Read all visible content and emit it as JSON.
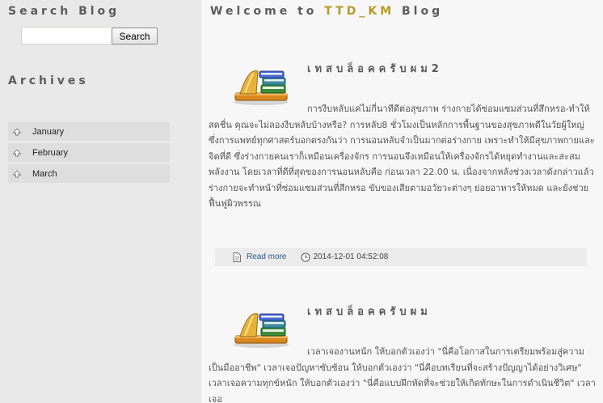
{
  "sidebar": {
    "search_heading": "Search Blog",
    "search_placeholder": "",
    "search_button": "Search",
    "archives_heading": "Archives",
    "archives": [
      {
        "label": "January",
        "icon": "arrow-up-icon"
      },
      {
        "label": "February",
        "icon": "arrow-up-icon"
      },
      {
        "label": "March",
        "icon": "arrow-up-icon"
      }
    ]
  },
  "main": {
    "welcome_prefix": "Welcome to",
    "welcome_brand": "TTD_KM",
    "welcome_suffix": "Blog",
    "posts": [
      {
        "title": "เทสบล็อคครับผม2",
        "body": "การงีบหลับแค่ไม่กี่นาทีดีต่อสุขภาพ ร่างกายได้ซ่อมแซมส่วนที่สึกหรอ-ทำให้สดชื่น คุณจะไม่ลองงีบหลับบ้างหรือ? การหลับ8 ชั่วโมงเป็นหลักการพื้นฐานของสุขภาพดีในวัยผู้ใหญ่ ซึ่งการแพทย์ทุกศาสตร์บอกตรงกันว่า การนอนหลับจำเป็นมากต่อร่างกาย เพราะทำให้มีสุขภาพกายและจิตที่ดี ซึ่งร่างกายคนเราก็เหมือนเครื่องจักร การนอนจึงเหมือนให้เครื่องจักรได้หยุดทำงานและสะสมพลังงาน โดยเวลาที่ดีที่สุดของการนอนหลับคือ ก่อนเวลา 22.00 น. เนื่องจากหลังช่วงเวลาดังกล่าวแล้วร่างกายจะทำหน้าที่ซ่อมแซมส่วนที่สึกหรอ ขับของเสียตามอวัยวะต่างๆ ย่อยอาหารให้หมด และยังช่วยฟื้นฟูผิวพรรณ",
        "read_more": "Read more",
        "date": "2014-12-01 04:52:08"
      },
      {
        "title": "เทสบล็อคครับผม",
        "body": "เวลาเจองานหนัก ให้บอกตัวเองว่า \"นี่คือโอกาสในการเตรียมพร้อมสู่ความเป็นมืออาชีพ\" เวลาเจอปัญหาซับซ้อน ให้บอกตัวเองว่า \"นี่คือบทเรียนที่จะสร้างปัญญาได้อย่างวิเศษ\" เวลาเจอความทุกข์หนัก ให้บอกตัวเองว่า \"นี่คือแบบฝึกหัดที่จะช่วยให้เกิดทักษะในการดำเนินชีวิต\" เวลาเจอ"
      }
    ]
  },
  "colors": {
    "brand": "#b89a28",
    "link": "#2a5a8a",
    "sidebar_bg": "#e9e9e9",
    "main_bg": "#f7f7f7"
  }
}
